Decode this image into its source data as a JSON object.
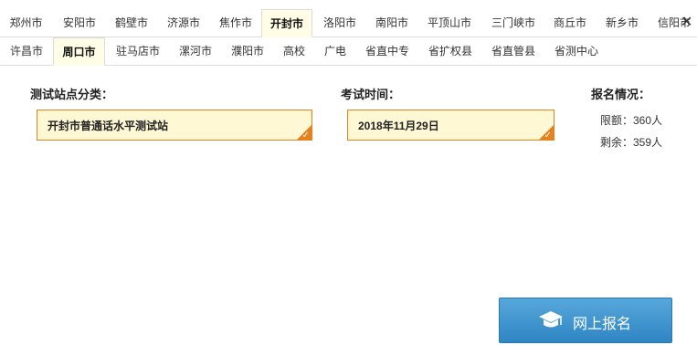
{
  "tabs_row1": [
    "郑州市",
    "安阳市",
    "鹤壁市",
    "济源市",
    "焦作市",
    "开封市",
    "洛阳市",
    "南阳市",
    "平顶山市",
    "三门峡市",
    "商丘市",
    "新乡市",
    "信阳市"
  ],
  "tabs_row2": [
    "许昌市",
    "周口市",
    "驻马店市",
    "漯河市",
    "濮阳市",
    "高校",
    "广电",
    "省直中专",
    "省扩权县",
    "省直管县",
    "省测中心"
  ],
  "active_row1": "开封市",
  "active_row2": "周口市",
  "category": {
    "label": "测试站点分类：",
    "value": "开封市普通话水平测试站"
  },
  "exam_time": {
    "label": "考试时间：",
    "value": "2018年11月29日"
  },
  "status": {
    "label": "报名情况：",
    "quota": "限额：360人",
    "remaining": "剩余：359人"
  },
  "register_button": {
    "label": "网上报名",
    "icon": "graduation-cap-icon"
  },
  "colors": {
    "accent_orange": "#e5821f",
    "button_blue": "#3a8fcc",
    "select_bg": "#fff8d4"
  }
}
